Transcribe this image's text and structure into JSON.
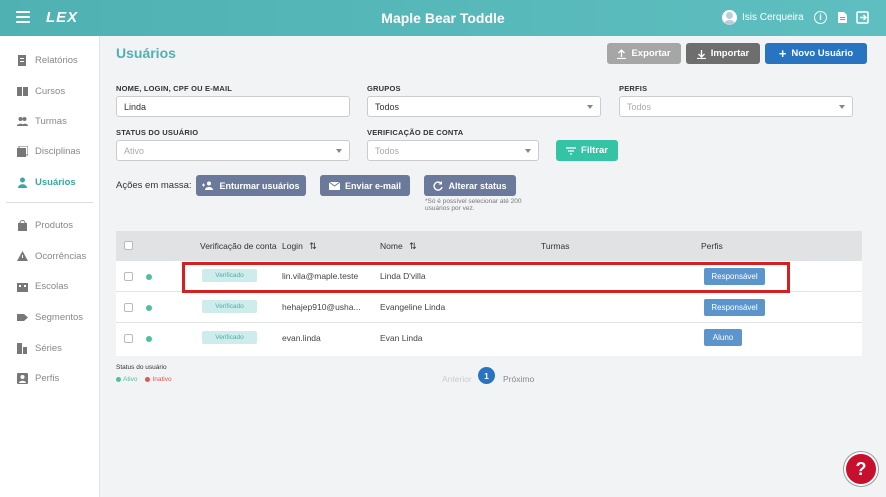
{
  "topbar": {
    "logo": "LEX",
    "title": "Maple Bear Toddle",
    "user_name": "Isis Cerqueira",
    "info_glyph": "i"
  },
  "sidebar": {
    "items": [
      {
        "label": "Relatórios",
        "icon": "report-icon"
      },
      {
        "label": "Cursos",
        "icon": "book-icon"
      },
      {
        "label": "Turmas",
        "icon": "group-icon"
      },
      {
        "label": "Disciplinas",
        "icon": "stack-icon"
      },
      {
        "label": "Usuários",
        "icon": "person-icon",
        "active": true
      },
      {
        "label": "Produtos",
        "icon": "bag-icon"
      },
      {
        "label": "Ocorrências",
        "icon": "warning-icon"
      },
      {
        "label": "Escolas",
        "icon": "building-icon"
      },
      {
        "label": "Segmentos",
        "icon": "tag-icon"
      },
      {
        "label": "Séries",
        "icon": "series-icon"
      },
      {
        "label": "Perfis",
        "icon": "profile-icon"
      }
    ]
  },
  "page": {
    "title": "Usuários",
    "export_label": "Exportar",
    "import_label": "Importar",
    "new_user_label": "Novo Usuário"
  },
  "filters": {
    "search_label": "NOME, LOGIN, CPF OU E-MAIL",
    "search_value": "Linda",
    "groups_label": "GRUPOS",
    "groups_value": "Todos",
    "profiles_label": "PERFIS",
    "profiles_placeholder": "Todos",
    "status_label": "STATUS DO USUÁRIO",
    "status_placeholder": "Ativo",
    "verification_label": "VERIFICAÇÃO DE CONTA",
    "verification_placeholder": "Todos",
    "filter_button": "Filtrar"
  },
  "mass_actions": {
    "label": "Ações em massa:",
    "enroll": "Enturmar usuários",
    "email": "Enviar e-mail",
    "status": "Alterar status",
    "note": "*Só é possível selecionar até 200 usuários por vez."
  },
  "table": {
    "headers": {
      "verification": "Verificação de conta",
      "login": "Login",
      "name": "Nome",
      "classes": "Turmas",
      "profiles": "Perfis"
    },
    "rows": [
      {
        "verification": "Verificado",
        "login": "lin.vila@maple.teste",
        "name": "Linda D'villa",
        "classes": "",
        "profile": "Responsável"
      },
      {
        "verification": "Verificado",
        "login": "hehajep910@usha...",
        "name": "Evangeline Linda",
        "classes": "",
        "profile": "Responsável"
      },
      {
        "verification": "Verificado",
        "login": "evan.linda",
        "name": "Evan Linda",
        "classes": "",
        "profile": "Aluno"
      }
    ]
  },
  "legend": {
    "title": "Status do usuário",
    "active": "Ativo",
    "inactive": "Inativo",
    "active_color": "#4cc0a0",
    "inactive_color": "#e05555"
  },
  "pagination": {
    "prev": "Anterior",
    "current": "1",
    "next": "Próximo"
  },
  "help": {
    "glyph": "?"
  },
  "colors": {
    "topbar": "#4fb1b2",
    "primary": "#2874c1",
    "filter": "#34c4a5",
    "highlight": "#d42020"
  }
}
